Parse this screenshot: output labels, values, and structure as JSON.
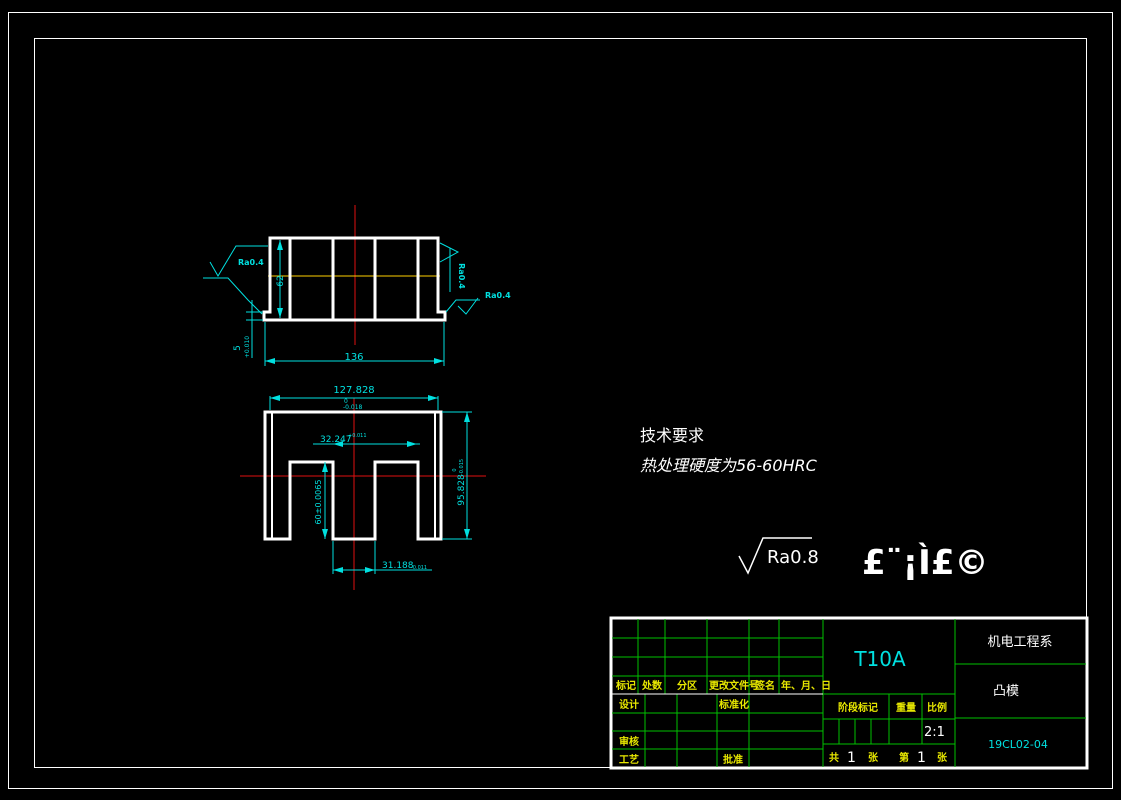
{
  "drawing": {
    "top_view": {
      "width_dim": "136",
      "height_dim": "62",
      "step_dim": "5",
      "step_tol": "+0.010",
      "roughness_left": "Ra0.4",
      "roughness_right": "Ra0.4",
      "roughness_vert": "Ra0.4"
    },
    "front_view": {
      "top_width_dim": "127.828",
      "top_width_tol_upper": "0",
      "top_width_tol_lower": "-0.018",
      "slot_width_dim": "32.247",
      "slot_width_tol": "+0.011",
      "slot_depth_dim": "60±0.0065",
      "bottom_dim": "31.188",
      "bottom_tol": "-0.011",
      "height_dim": "95.828",
      "height_tol_upper": "0",
      "height_tol_lower": "-0.015"
    },
    "tech_req_title": "技术要求",
    "tech_req_text": "热处理硬度为56-60HRC",
    "roughness_general": "Ra0.8",
    "garbled_text": "£¨¡Ì£©"
  },
  "title_block": {
    "material": "T10A",
    "department": "机电工程系",
    "part_name": "凸模",
    "drawing_no": "19CL02-04",
    "scale_value": "2:1",
    "headers": {
      "mark": "标记",
      "count": "处数",
      "zone": "分区",
      "change_doc": "更改文件号",
      "sign": "签名",
      "date": "年、月、日",
      "design": "设计",
      "standardize": "标准化",
      "review": "审核",
      "process": "工艺",
      "approve": "批准",
      "stage_mark": "阶段标记",
      "weight": "重量",
      "scale": "比例"
    },
    "sheet": {
      "total_label": "共",
      "total_value": "1",
      "sheet_unit": "张",
      "current_label": "第",
      "current_value": "1",
      "current_unit": "张"
    }
  }
}
